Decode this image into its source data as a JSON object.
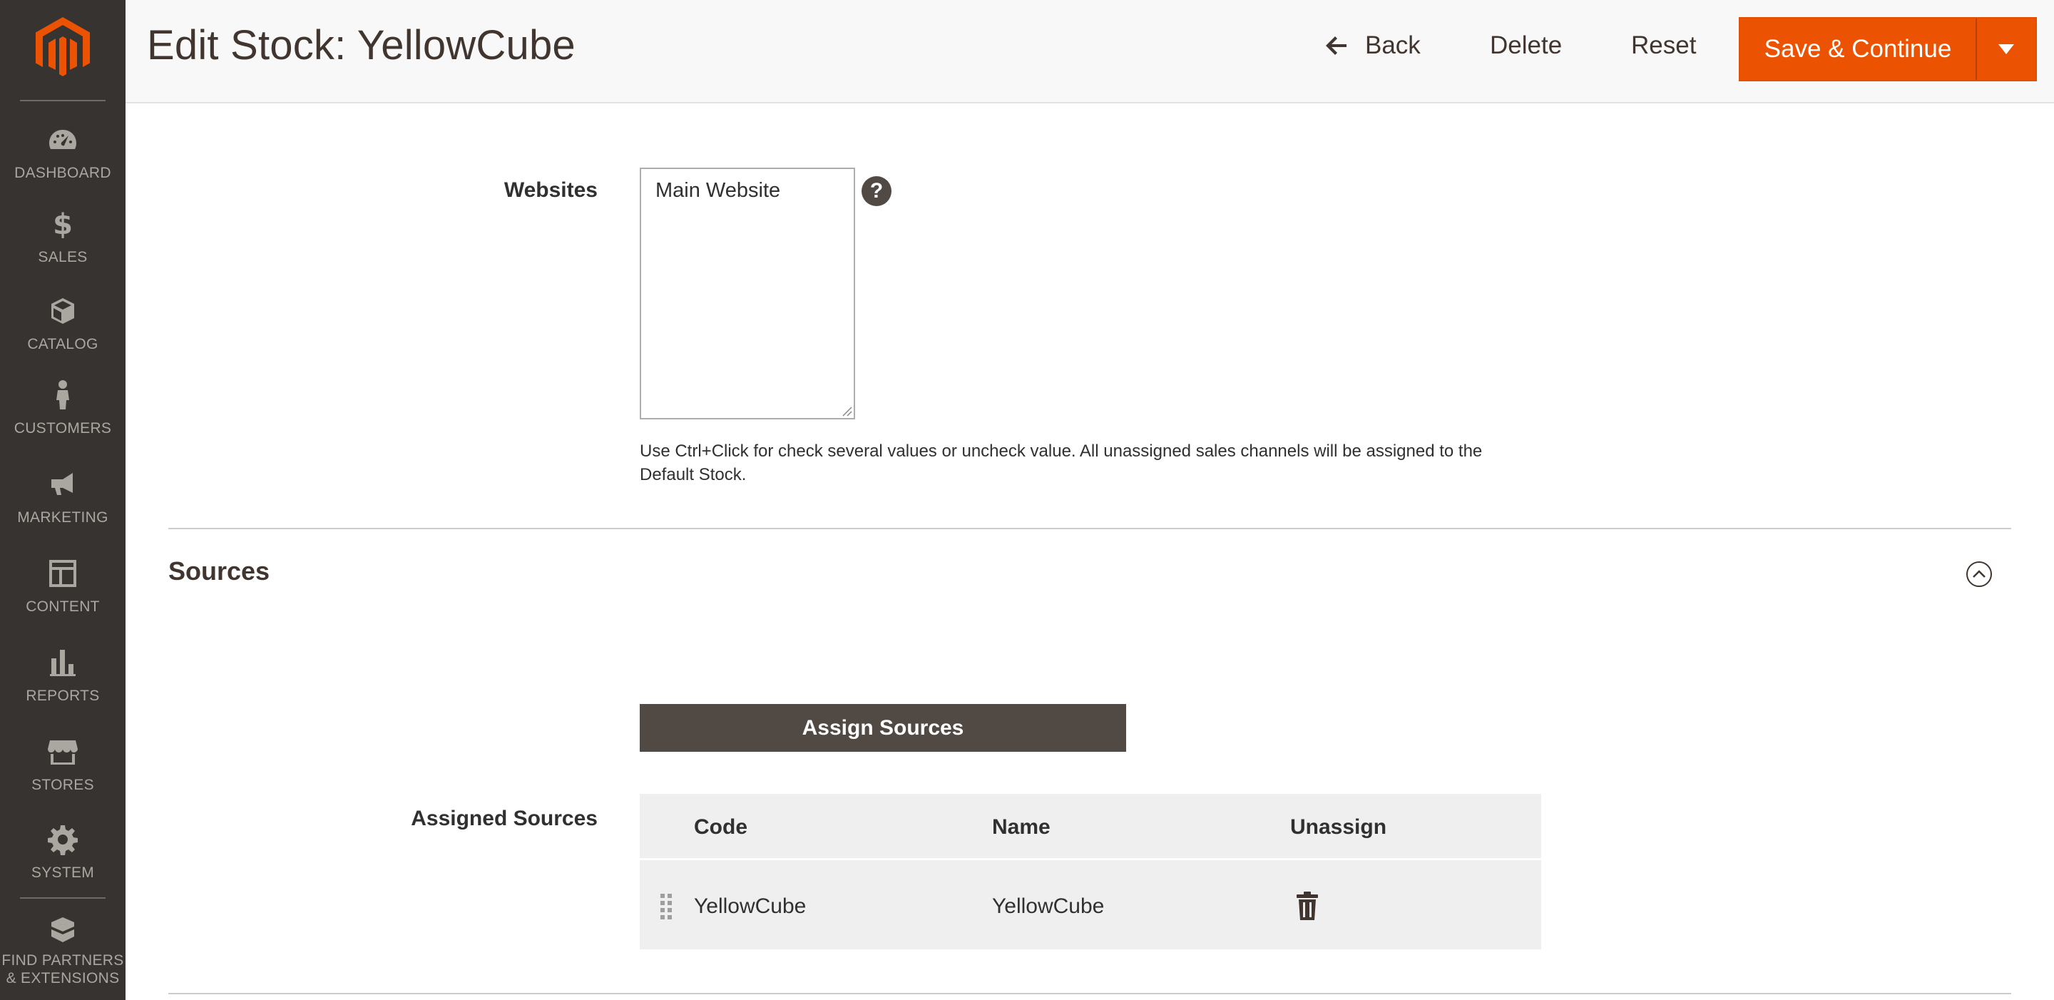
{
  "sidebar": {
    "items": [
      {
        "label": "DASHBOARD",
        "icon": "dashboard-icon"
      },
      {
        "label": "SALES",
        "icon": "dollar-icon"
      },
      {
        "label": "CATALOG",
        "icon": "box-icon"
      },
      {
        "label": "CUSTOMERS",
        "icon": "person-icon"
      },
      {
        "label": "MARKETING",
        "icon": "megaphone-icon"
      },
      {
        "label": "CONTENT",
        "icon": "layout-icon"
      },
      {
        "label": "REPORTS",
        "icon": "bar-chart-icon"
      },
      {
        "label": "STORES",
        "icon": "storefront-icon"
      },
      {
        "label": "SYSTEM",
        "icon": "gear-icon"
      }
    ],
    "partners_line1": "FIND PARTNERS",
    "partners_line2": "& EXTENSIONS"
  },
  "header": {
    "title": "Edit Stock: YellowCube",
    "back_label": "Back",
    "delete_label": "Delete",
    "reset_label": "Reset",
    "save_label": "Save & Continue"
  },
  "websites": {
    "label": "Websites",
    "options": [
      "Main Website"
    ],
    "help_glyph": "?",
    "note": "Use Ctrl+Click for check several values or uncheck value. All unassigned sales channels will be assigned to the Default Stock."
  },
  "sources": {
    "title": "Sources",
    "assign_button_label": "Assign Sources",
    "assigned_label": "Assigned Sources",
    "columns": {
      "code": "Code",
      "name": "Name",
      "unassign": "Unassign"
    },
    "rows": [
      {
        "code": "YellowCube",
        "name": "YellowCube"
      }
    ]
  },
  "colors": {
    "sidebar_bg": "#373330",
    "accent": "#eb5202",
    "dark_button": "#514943"
  }
}
